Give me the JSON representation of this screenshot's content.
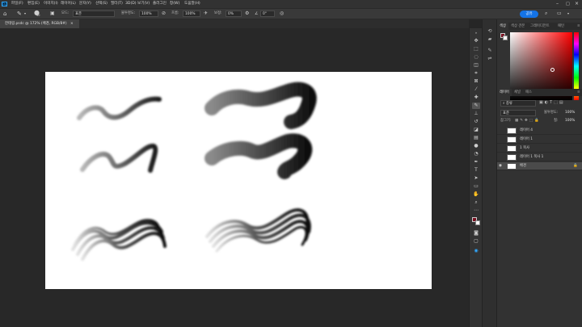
{
  "app": {
    "logo": "Ps",
    "accent": "#31a8ff"
  },
  "menu": [
    "파일(F)",
    "편집(E)",
    "이미지(I)",
    "레이어(L)",
    "문자(Y)",
    "선택(S)",
    "필터(T)",
    "3D(D)",
    "보기(V)",
    "플러그인",
    "창(W)",
    "도움말(H)"
  ],
  "options": {
    "brush_size": "40",
    "mode_label": "모드:",
    "mode_value": "표준",
    "opacity_label": "불투명도:",
    "opacity_value": "100%",
    "flow_label": "흐름:",
    "flow_value": "100%",
    "smoothing_label": "보정:",
    "smoothing_value": "0%",
    "angle_value": "0°",
    "share_label": "공유"
  },
  "document_tab": {
    "title": "한테링.psdc @ 172% (배경, RGB/8#)",
    "close": "×"
  },
  "color_panel": {
    "tabs": [
      "색상",
      "색상 견본",
      "그레이디언트",
      "패턴"
    ],
    "accent": "#ff0000"
  },
  "layers_panel": {
    "tabs": [
      "레이어",
      "채널",
      "패스"
    ],
    "filter_label": "종류",
    "blend_mode": "표준",
    "opacity_label": "불투명도:",
    "opacity_value": "100%",
    "fill_label": "칠:",
    "fill_value": "100%",
    "lock_label": "잠그기:",
    "layers": [
      {
        "name": "레이어 4",
        "visible": false,
        "selected": false
      },
      {
        "name": "레이어 1",
        "visible": false,
        "selected": false
      },
      {
        "name": "1 복사",
        "visible": false,
        "selected": false
      },
      {
        "name": "레이어 1 복사 1",
        "visible": false,
        "selected": false
      },
      {
        "name": "배경",
        "visible": true,
        "selected": true
      }
    ]
  },
  "icons": {
    "home": "home-icon",
    "brush": "brush-icon",
    "move": "move-icon",
    "lasso": "lasso-icon",
    "eye": "eye-icon",
    "lock": "lock-icon",
    "search": "search-icon",
    "settings": "gear-icon"
  }
}
